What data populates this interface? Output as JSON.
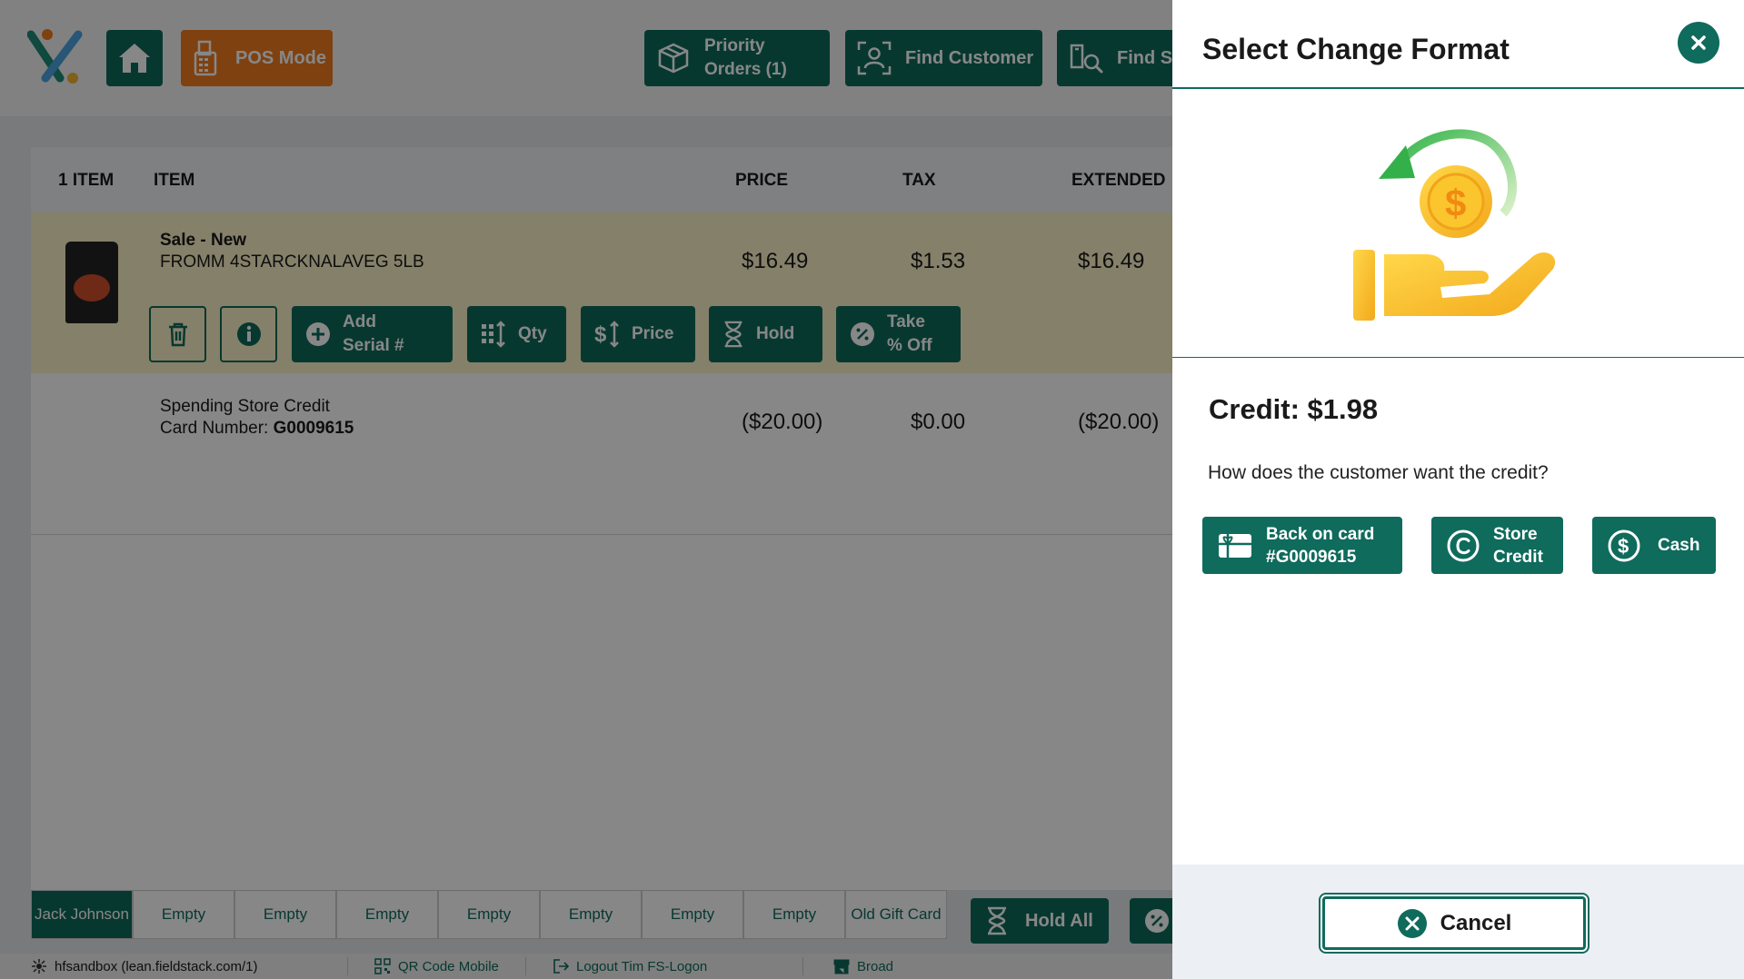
{
  "header": {
    "pos_mode": "POS Mode",
    "priority_orders_line1": "Priority",
    "priority_orders_line2": "Orders (1)",
    "find_customer": "Find Customer",
    "find_s": "Find S"
  },
  "cart": {
    "columns": {
      "count": "1 ITEM",
      "item": "ITEM",
      "price": "PRICE",
      "tax": "TAX",
      "extended": "EXTENDED"
    },
    "line1": {
      "type": "Sale - New",
      "description": "FROMM 4STARCKNALAVEG 5LB",
      "price": "$16.49",
      "tax": "$1.53",
      "extended": "$16.49"
    },
    "line2": {
      "description": "Spending Store Credit",
      "card_label": "Card Number:",
      "card_number": "G0009615",
      "price": "($20.00)",
      "tax": "$0.00",
      "extended": "($20.00)"
    },
    "actions": {
      "add_serial_line1": "Add",
      "add_serial_line2": "Serial #",
      "qty": "Qty",
      "price": "Price",
      "hold": "Hold",
      "take_off_line1": "Take",
      "take_off_line2": "% Off"
    }
  },
  "tabs": [
    "Jack Johnson",
    "Empty",
    "Empty",
    "Empty",
    "Empty",
    "Empty",
    "Empty",
    "Empty",
    "Old Gift Card"
  ],
  "hold_all": "Hold All",
  "statusbar": {
    "host": "hfsandbox (lean.fieldstack.com/1)",
    "qr": "QR Code Mobile",
    "logout": "Logout Tim FS-Logon",
    "store": "Broad"
  },
  "panel": {
    "title": "Select Change Format",
    "credit": "Credit: $1.98",
    "question": "How does the customer want the credit?",
    "back_on_card_line1": "Back on card",
    "back_on_card_line2": "#G0009615",
    "store_credit_line1": "Store",
    "store_credit_line2": "Credit",
    "cash": "Cash",
    "cancel": "Cancel"
  },
  "colors": {
    "primary": "#0f6b5c",
    "pos_mode": "#f07b1e",
    "row_highlight": "#fbf1c7"
  }
}
